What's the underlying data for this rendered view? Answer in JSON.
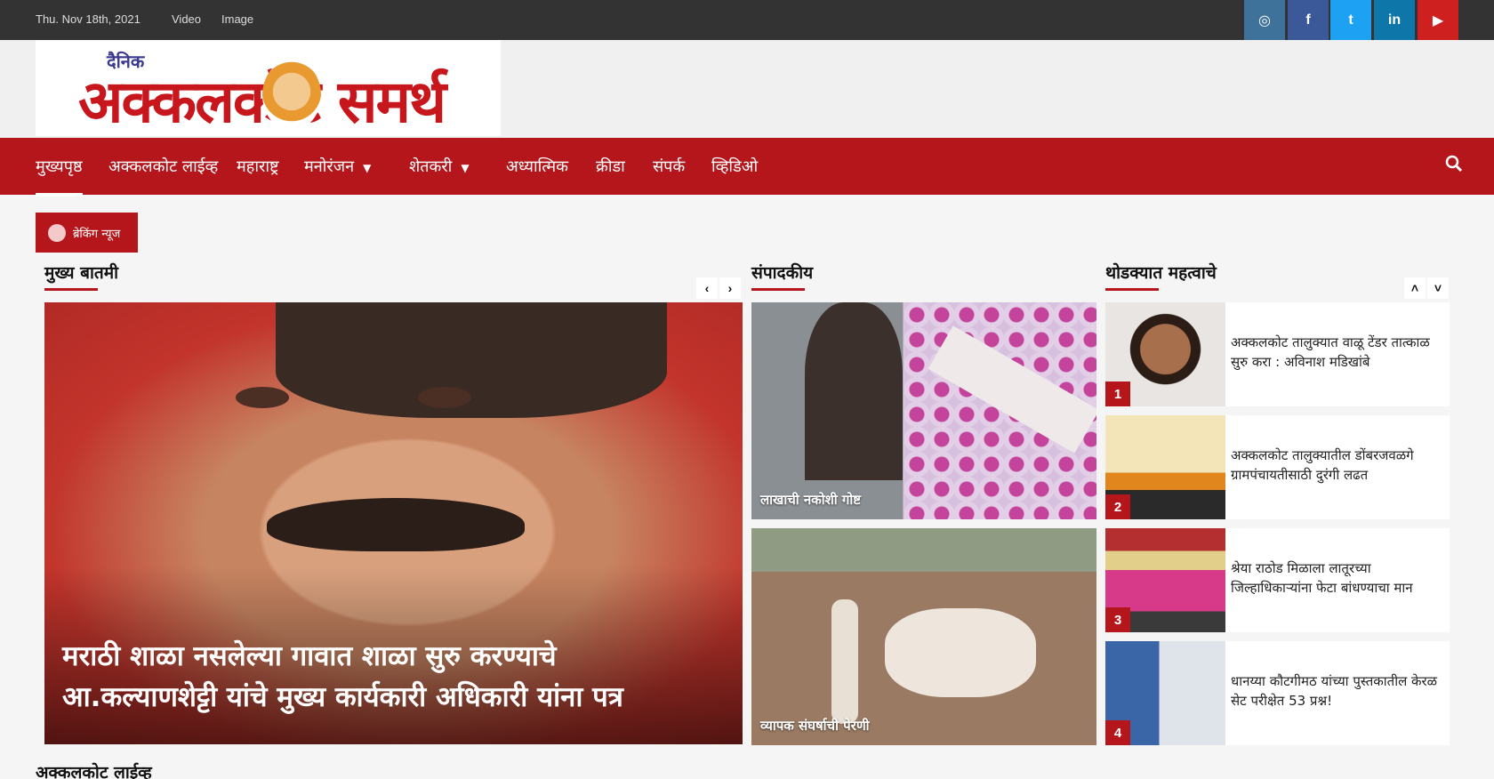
{
  "topbar": {
    "date": "Thu. Nov 18th, 2021",
    "links": [
      "Video",
      "Image"
    ],
    "social": [
      {
        "name": "instagram-icon",
        "glyph": "◎",
        "color": "#3f729b"
      },
      {
        "name": "facebook-icon",
        "glyph": "f",
        "color": "#3b5998"
      },
      {
        "name": "twitter-icon",
        "glyph": "t",
        "color": "#1da1f2"
      },
      {
        "name": "linkedin-icon",
        "glyph": "in",
        "color": "#0e76a8"
      },
      {
        "name": "youtube-icon",
        "glyph": "▶",
        "color": "#cd201f"
      }
    ]
  },
  "logo": {
    "small": "दैनिक",
    "big": "अक्कलकोट समर्थ"
  },
  "nav": {
    "items": [
      {
        "label": "मुख्यपृष्ठ",
        "active": true
      },
      {
        "label": "अक्कलकोट लाईव्ह"
      },
      {
        "label": "महाराष्ट्र"
      },
      {
        "label": "मनोरंजन",
        "dropdown": true
      },
      {
        "label": "शेतकरी",
        "dropdown": true
      },
      {
        "label": "अध्यात्मिक"
      },
      {
        "label": "क्रीडा"
      },
      {
        "label": "संपर्क"
      },
      {
        "label": "व्हिडिओ"
      }
    ]
  },
  "breaking": {
    "label": "ब्रेकिंग न्यूज"
  },
  "main_news": {
    "title": "मुख्य बातमी",
    "headline": "मराठी शाळा नसलेल्या गावात शाळा सुरु करण्याचे आ.कल्याणशेट्टी यांचे मुख्य कार्यकारी अधिकारी यांना पत्र",
    "prev": "‹",
    "next": "›"
  },
  "editorial": {
    "title": "संपादकीय",
    "cards": [
      {
        "caption": "लाखाची नकोशी गोष्ट"
      },
      {
        "caption": "व्यापक संघर्षाची पेरणी"
      }
    ]
  },
  "short_news": {
    "title": "थोडक्यात महत्वाचे",
    "up": "˄",
    "down": "˅",
    "items": [
      {
        "num": "1",
        "text": "अक्कलकोट तालुक्यात वाळू टेंडर तात्काळ सुरु करा : अविनाश मडिखांबे"
      },
      {
        "num": "2",
        "text": "अक्कलकोट तालुक्यातील डोंबरजवळगे ग्रामपंचायतीसाठी दुरंगी लढत"
      },
      {
        "num": "3",
        "text": "श्रेया राठोड मिळाला लातूरच्या जिल्हाधिकाऱ्यांना फेटा बांधण्याचा मान"
      },
      {
        "num": "4",
        "text": "धानय्या कौटगीमठ यांच्या पुस्तकातील केरळ सेट परीक्षेत 53 प्रश्न!"
      }
    ]
  },
  "section_below": {
    "title": "अक्कलकोट लाईव्ह"
  }
}
